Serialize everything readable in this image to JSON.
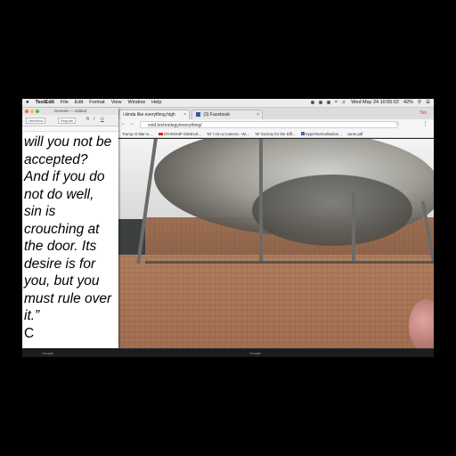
{
  "menubar": {
    "app": "TextEdit",
    "items": [
      "File",
      "Edit",
      "Format",
      "View",
      "Window",
      "Help"
    ],
    "clock": "Wed May 24  10:55:02",
    "battery": "42%"
  },
  "textedit": {
    "title": "Genesis — Edited",
    "font": "Helvetica",
    "style": "Regular",
    "lines": [
      "will you not be",
      "accepted?",
      "And if you do",
      "not do well,",
      "sin is",
      "crouching at",
      "the door. Its",
      "desire is for",
      "you, but you",
      "must rule over",
      "it.”"
    ],
    "cursor_line": "C"
  },
  "browser": {
    "tabs": [
      {
        "label": "i kinda like everything.high"
      },
      {
        "label": "(3) Facebook"
      }
    ],
    "profile": "Tim",
    "url": "void.technology/everything/",
    "bookmarks": [
      "Trump At Mar-a-...",
      "STARSHIP GENIUS...",
      "'W' I Am a Camera - Wi...",
      "'W' Society for the Diff...",
      "HyperNormalisation...",
      "carse.pdf"
    ]
  },
  "dock": {
    "items": [
      "Google",
      "Google"
    ]
  }
}
